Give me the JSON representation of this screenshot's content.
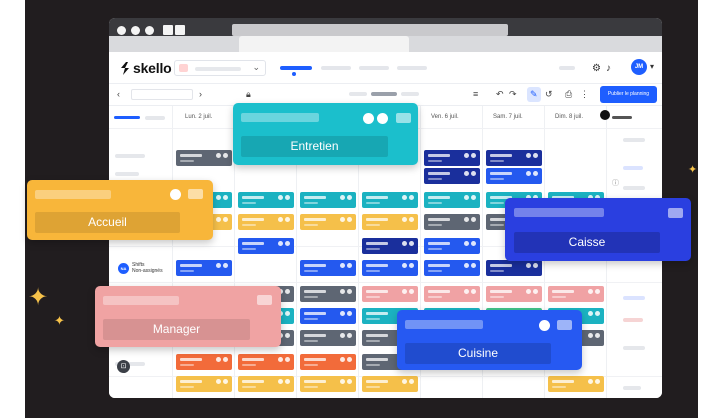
{
  "app": {
    "logo_text": "skello",
    "avatar_initials": "JM",
    "publish_label": "Publier le planning"
  },
  "days": [
    {
      "label": "Lun. 2 juil."
    },
    {
      "label": "Ven. 6 juil."
    },
    {
      "label": "Sam. 7 juil."
    },
    {
      "label": "Dim. 8 juil."
    }
  ],
  "unassigned": {
    "badge": "NA",
    "label_line1": "Shifts",
    "label_line2": "Non-assignés"
  },
  "cards": {
    "entretien": {
      "label": "Entretien",
      "color": "#1bbfcc"
    },
    "accueil": {
      "label": "Accueil",
      "color": "#f8b63a"
    },
    "caisse": {
      "label": "Caisse",
      "color": "#2a3fe0"
    },
    "manager": {
      "label": "Manager",
      "color": "#f0a3a3"
    },
    "cuisine": {
      "label": "Cuisine",
      "color": "#2659f2"
    }
  },
  "colors": {
    "navy": "#1a2f9c",
    "teal": "#1bb2c1",
    "yellow": "#f5c04a",
    "gray": "#5e6673",
    "blue": "#2459ef",
    "pink": "#f0a2a4",
    "green": "#43c28a",
    "orange": "#f26b3a"
  },
  "icons": [
    "logo-mark-icon",
    "chevron-down-icon",
    "chevron-left-icon",
    "chevron-right-icon",
    "filter-icon",
    "undo-icon",
    "redo-icon",
    "print-icon",
    "more-icon",
    "gear-icon",
    "bell-icon",
    "star-icon"
  ]
}
